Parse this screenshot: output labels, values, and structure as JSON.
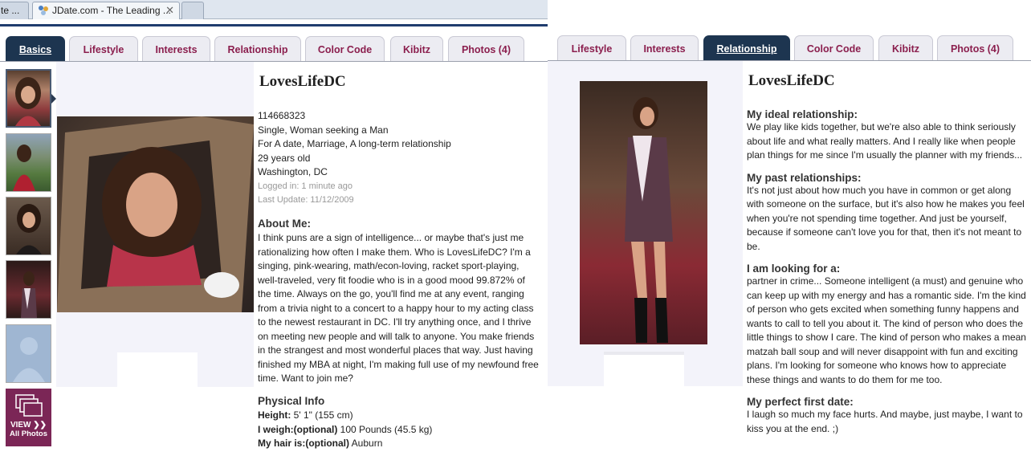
{
  "browser": {
    "tabs": [
      {
        "label": "te ..."
      },
      {
        "label": "JDate.com - The Leading ..."
      },
      {
        "label": ""
      }
    ],
    "close_glyph": "✕"
  },
  "left": {
    "tabs": [
      "Basics",
      "Lifestyle",
      "Interests",
      "Relationship",
      "Color Code",
      "Kibitz",
      "Photos (4)"
    ],
    "active_tab": "Basics",
    "username": "LovesLifeDC",
    "info": {
      "id": "114668323",
      "seeking": "Single, Woman seeking a Man",
      "for": "For A date, Marriage, A long-term relationship",
      "age": "29 years old",
      "location": "Washington, DC",
      "logged_in": "Logged in: 1 minute ago",
      "last_update": "Last Update: 11/12/2009"
    },
    "about_heading": "About Me:",
    "about_text": "I think puns are a sign of intelligence... or maybe that's just me rationalizing how often I make them. Who is LovesLifeDC? I'm a singing, pink-wearing, math/econ-loving, racket sport-playing, well-traveled, very fit foodie who is in a good mood 99.872% of the time. Always on the go, you'll find me at any event, ranging from a trivia night to a concert to a happy hour to my acting class to the newest restaurant in DC. I'll try anything once, and I thrive on meeting new people and will talk to anyone. You make friends in the strangest and most wonderful places that way. Just having finished my MBA at night, I'm making full use of my newfound free time. Want to join me?",
    "physical_heading": "Physical Info",
    "physical": [
      {
        "label": "Height:",
        "value": "5' 1\" (155 cm)"
      },
      {
        "label": "I weigh:(optional)",
        "value": "100 Pounds (45.5 kg)"
      },
      {
        "label": "My hair is:(optional)",
        "value": "Auburn"
      }
    ],
    "view_all": {
      "line1": "VIEW",
      "line2": "All Photos",
      "arrows": "❯❯"
    }
  },
  "right": {
    "tabs": [
      "Lifestyle",
      "Interests",
      "Relationship",
      "Color Code",
      "Kibitz",
      "Photos (4)"
    ],
    "active_tab": "Relationship",
    "username": "LovesLifeDC",
    "sections": [
      {
        "heading": "My ideal relationship:",
        "text": "We play like kids together, but we're also able to think seriously about life and what really matters. And I really like when people plan things for me since I'm usually the planner with my friends..."
      },
      {
        "heading": "My past relationships:",
        "text": "It's not just about how much you have in common or get along with someone on the surface, but it's also how he makes you feel when you're not spending time together. And just be yourself, because if someone can't love you for that, then it's not meant to be."
      },
      {
        "heading": "I am looking for a:",
        "text": "partner in crime... Someone intelligent (a must) and genuine who can keep up with my energy and has a romantic side. I'm the kind of person who gets excited when something funny happens and wants to call to tell you about it. The kind of person who does the little things to show I care. The kind of person who makes a mean matzah ball soup and will never disappoint with fun and exciting plans. I'm looking for someone who knows how to appreciate these things and wants to do them for me too."
      },
      {
        "heading": "My perfect first date:",
        "text": "I laugh so much my face hurts. And maybe, just maybe, I want to kiss you at the end. ;)"
      }
    ]
  },
  "colors": {
    "active_tab": "#1d3550",
    "tab_text": "#8b1f4e",
    "view_all_bg": "#7b2656"
  }
}
